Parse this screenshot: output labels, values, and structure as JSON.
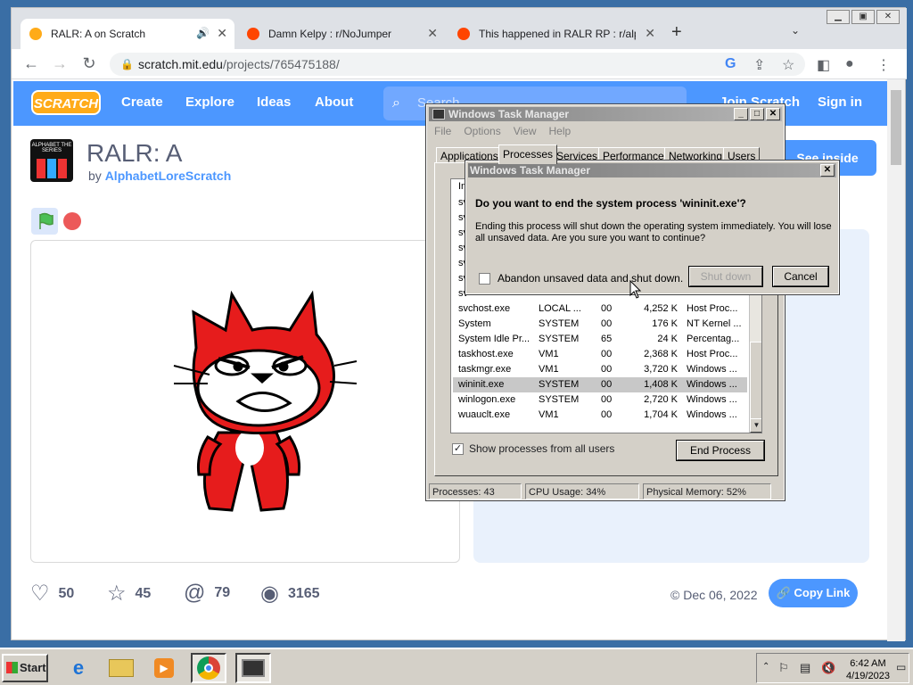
{
  "browser": {
    "tabs": [
      {
        "label": "RALR: A on Scratch",
        "active": true
      },
      {
        "label": "Damn Kelpy : r/NoJumper",
        "active": false
      },
      {
        "label": "This happened in RALR RP : r/alpha",
        "active": false
      }
    ],
    "new_tab": "+",
    "url_host": "scratch.mit.edu",
    "url_path": "/projects/765475188/"
  },
  "scratch": {
    "logo": "SCRATCH",
    "nav": [
      "Create",
      "Explore",
      "Ideas",
      "About"
    ],
    "search_placeholder": "Search",
    "join": "Join Scratch",
    "signin": "Sign in",
    "project_title": "RALR: A",
    "by_prefix": "by",
    "author": "AlphabetLoreScratch",
    "thumb_text": "ALPHABET THE SERIES",
    "see_inside": "See inside",
    "stats": {
      "loves": "50",
      "favorites": "45",
      "remixes": "79",
      "views": "3165"
    },
    "share_date": "Dec 06, 2022",
    "copy_link": "Copy Link"
  },
  "taskmgr": {
    "title": "Windows Task Manager",
    "menu": [
      "File",
      "Options",
      "View",
      "Help"
    ],
    "tabs": [
      "Applications",
      "Processes",
      "Services",
      "Performance",
      "Networking",
      "Users"
    ],
    "active_tab": "Processes",
    "partial_rows": [
      "sv",
      "sv",
      "sv",
      "sv",
      "sv",
      "sv",
      "sv"
    ],
    "header_partial": "In",
    "processes": [
      {
        "name": "svchost.exe",
        "user": "LOCAL ...",
        "cpu": "00",
        "mem": "4,252 K",
        "desc": "Host Proc..."
      },
      {
        "name": "System",
        "user": "SYSTEM",
        "cpu": "00",
        "mem": "176 K",
        "desc": "NT Kernel ..."
      },
      {
        "name": "System Idle Pr...",
        "user": "SYSTEM",
        "cpu": "65",
        "mem": "24 K",
        "desc": "Percentag..."
      },
      {
        "name": "taskhost.exe",
        "user": "VM1",
        "cpu": "00",
        "mem": "2,368 K",
        "desc": "Host Proc..."
      },
      {
        "name": "taskmgr.exe",
        "user": "VM1",
        "cpu": "00",
        "mem": "3,720 K",
        "desc": "Windows ..."
      },
      {
        "name": "wininit.exe",
        "user": "SYSTEM",
        "cpu": "00",
        "mem": "1,408 K",
        "desc": "Windows ..."
      },
      {
        "name": "winlogon.exe",
        "user": "SYSTEM",
        "cpu": "00",
        "mem": "2,720 K",
        "desc": "Windows ..."
      },
      {
        "name": "wuauclt.exe",
        "user": "VM1",
        "cpu": "00",
        "mem": "1,704 K",
        "desc": "Windows ..."
      }
    ],
    "selected_process": "wininit.exe",
    "show_all_label": "Show processes from all users",
    "show_all_checked": true,
    "end_process": "End Process",
    "status": {
      "processes": "Processes: 43",
      "cpu": "CPU Usage: 34%",
      "memory": "Physical Memory: 52%"
    }
  },
  "dialog": {
    "title": "Windows Task Manager",
    "question": "Do you want to end the system process 'wininit.exe'?",
    "message": "Ending this process will shut down the operating system immediately.  You will lose all unsaved data.  Are you sure you want to continue?",
    "checkbox_label": "Abandon unsaved data and shut down.",
    "checkbox_checked": false,
    "shutdown": "Shut down",
    "cancel": "Cancel"
  },
  "taskbar": {
    "start": "Start",
    "time": "6:42 AM",
    "date": "4/19/2023"
  }
}
